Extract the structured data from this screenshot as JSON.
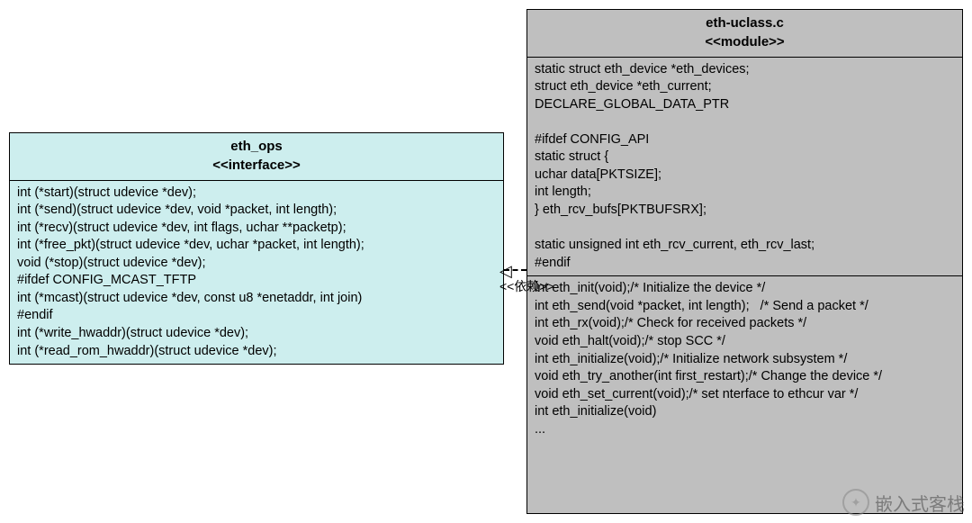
{
  "interface_box": {
    "title": "eth_ops",
    "stereotype": "<<interface>>",
    "lines": [
      "int (*start)(struct udevice *dev);",
      "int (*send)(struct udevice *dev, void *packet, int length);",
      "int (*recv)(struct udevice *dev, int flags, uchar **packetp);",
      "int (*free_pkt)(struct udevice *dev, uchar *packet, int length);",
      "void (*stop)(struct udevice *dev);",
      "#ifdef CONFIG_MCAST_TFTP",
      "int (*mcast)(struct udevice *dev, const u8 *enetaddr, int join)",
      "#endif",
      "int (*write_hwaddr)(struct udevice *dev);",
      "int (*read_rom_hwaddr)(struct udevice *dev);"
    ]
  },
  "module_box": {
    "title": "eth-uclass.c",
    "stereotype": "<<module>>",
    "section1": [
      "static struct eth_device *eth_devices;",
      "struct eth_device *eth_current;",
      "DECLARE_GLOBAL_DATA_PTR",
      "",
      "#ifdef CONFIG_API",
      "static struct {",
      "uchar data[PKTSIZE];",
      "int length;",
      "} eth_rcv_bufs[PKTBUFSRX];",
      "",
      "static unsigned int eth_rcv_current, eth_rcv_last;",
      "#endif"
    ],
    "section2": [
      "int eth_init(void);/* Initialize the device */",
      "int eth_send(void *packet, int length);   /* Send a packet */",
      "int eth_rx(void);/* Check for received packets */",
      "void eth_halt(void);/* stop SCC */",
      "int eth_initialize(void);/* Initialize network subsystem */",
      "void eth_try_another(int first_restart);/* Change the device */",
      "void eth_set_current(void);/* set nterface to ethcur var */",
      "int eth_initialize(void)",
      "..."
    ]
  },
  "dependency_label": "<<依赖>>",
  "watermark_text": "嵌入式客栈"
}
